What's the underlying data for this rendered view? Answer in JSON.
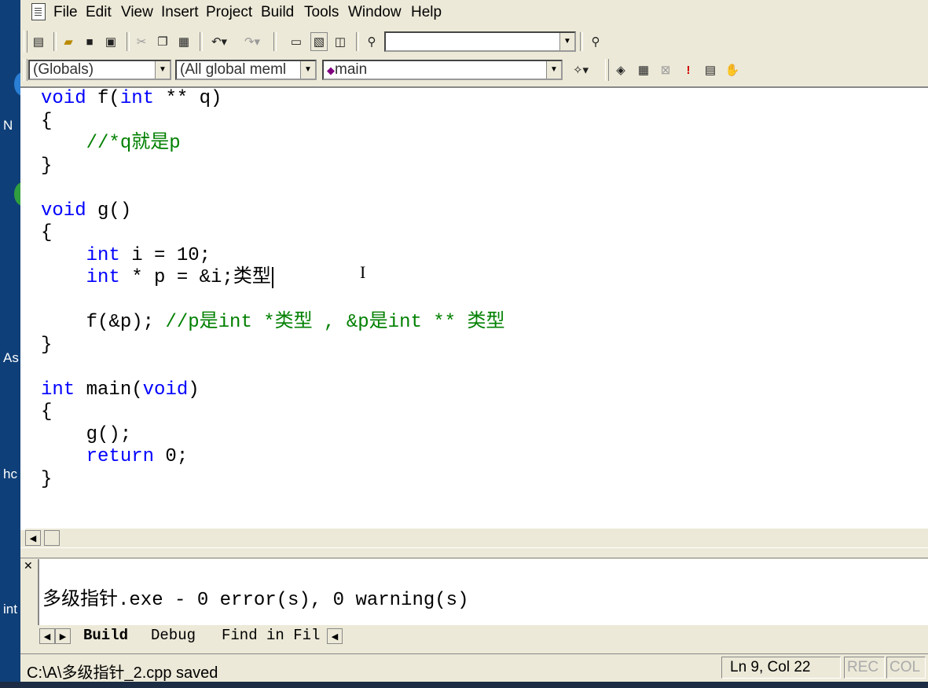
{
  "desktop": {
    "labels": [
      "N",
      "As",
      "hc",
      "int"
    ]
  },
  "menu": [
    "File",
    "Edit",
    "View",
    "Insert",
    "Project",
    "Build",
    "Tools",
    "Window",
    "Help"
  ],
  "toolbar2": {
    "globals": "(Globals)",
    "members": "(All global meml",
    "function": "main"
  },
  "code": [
    [
      [
        "kw",
        "void"
      ],
      [
        "t",
        " f("
      ],
      [
        "kw",
        "int"
      ],
      [
        "t",
        " ** q)"
      ]
    ],
    [
      [
        "t",
        "{"
      ]
    ],
    [
      [
        "t",
        "    "
      ],
      [
        "cm",
        "//*q就是p"
      ]
    ],
    [
      [
        "t",
        "}"
      ]
    ],
    [
      [
        "t",
        ""
      ]
    ],
    [
      [
        "kw",
        "void"
      ],
      [
        "t",
        " g()"
      ]
    ],
    [
      [
        "t",
        "{"
      ]
    ],
    [
      [
        "t",
        "    "
      ],
      [
        "kw",
        "int"
      ],
      [
        "t",
        " i = 10;"
      ]
    ],
    [
      [
        "t",
        "    "
      ],
      [
        "kw",
        "int"
      ],
      [
        "t",
        " * p = &i;类型"
      ]
    ],
    [
      [
        "t",
        ""
      ]
    ],
    [
      [
        "t",
        "    f(&p); "
      ],
      [
        "cm",
        "//p是int *类型 , &p是int ** 类型"
      ]
    ],
    [
      [
        "t",
        "}"
      ]
    ],
    [
      [
        "t",
        ""
      ]
    ],
    [
      [
        "kw",
        "int"
      ],
      [
        "t",
        " main("
      ],
      [
        "kw",
        "void"
      ],
      [
        "t",
        ")"
      ]
    ],
    [
      [
        "t",
        "{"
      ]
    ],
    [
      [
        "t",
        "    g();"
      ]
    ],
    [
      [
        "t",
        "    "
      ],
      [
        "kw",
        "return"
      ],
      [
        "t",
        " 0;"
      ]
    ],
    [
      [
        "t",
        "}"
      ]
    ]
  ],
  "output": {
    "line": "多级指针.exe - 0 error(s), 0 warning(s)"
  },
  "outtabs": [
    "Build",
    "Debug",
    "Find in Fil"
  ],
  "status": {
    "message": "C:\\A\\多级指针_2.cpp saved",
    "position": "Ln 9, Col 22",
    "rec": "REC",
    "col": "COL"
  }
}
